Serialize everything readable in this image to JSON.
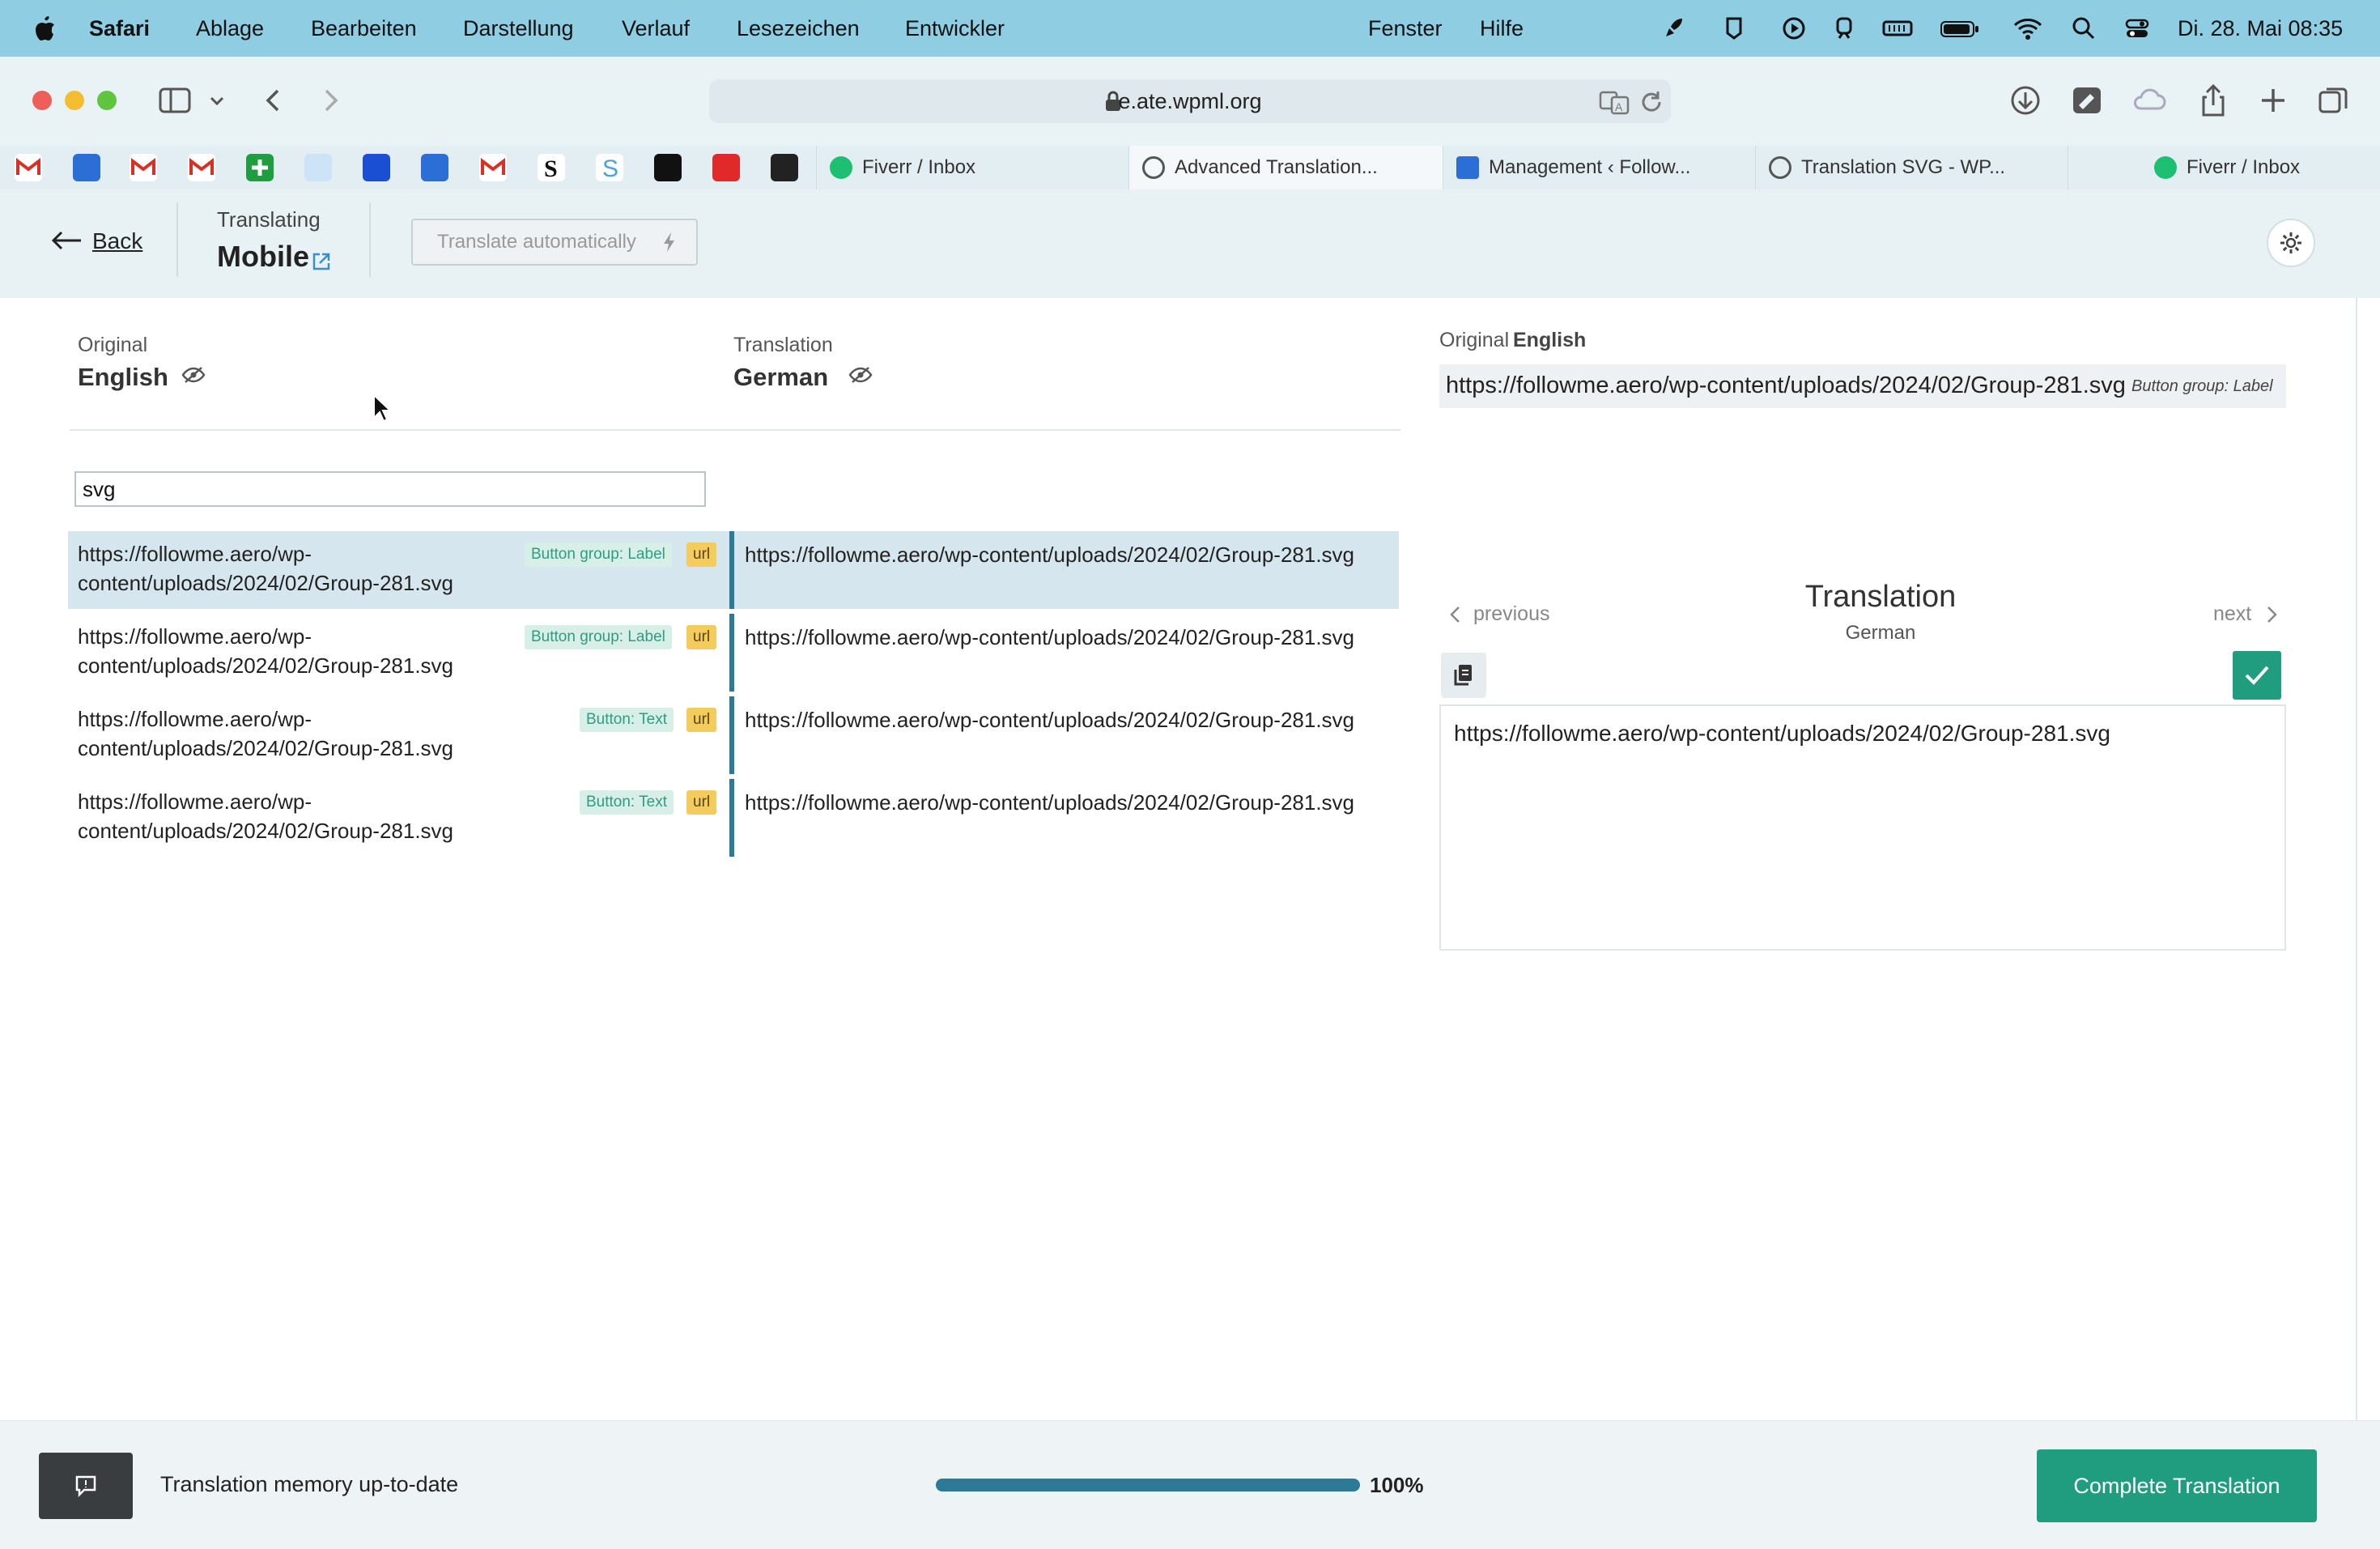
{
  "menubar": {
    "app_name": "Safari",
    "items": [
      "Ablage",
      "Bearbeiten",
      "Darstellung",
      "Verlauf",
      "Lesezeichen",
      "Entwickler",
      "Fenster",
      "Hilfe"
    ],
    "clock": "Di. 28. Mai  08:35"
  },
  "browser": {
    "url": "e.ate.wpml.org",
    "tabs": [
      {
        "label": "Fiverr / Inbox",
        "icon": "fiverr-icon"
      },
      {
        "label": "Advanced Translation...",
        "icon": "wpml-icon",
        "active": true
      },
      {
        "label": "Management ‹ Follow...",
        "icon": "management-icon"
      },
      {
        "label": "Translation SVG - WP...",
        "icon": "wpml-icon"
      },
      {
        "label": "Fiverr / Inbox",
        "icon": "fiverr-icon"
      }
    ]
  },
  "header": {
    "back_label": "Back",
    "translating_label": "Translating",
    "doc_title": "Mobile",
    "auto_translate_label": "Translate automatically"
  },
  "languages": {
    "original_label": "Original",
    "original_name": "English",
    "translation_label": "Translation",
    "translation_name": "German"
  },
  "search": {
    "value": "svg"
  },
  "rows": [
    {
      "source": "https://followme.aero/wp-content/uploads/2024/02/Group-281.svg",
      "source_line1": "https://followme.aero/wp-",
      "source_line2": "content/uploads/2024/02/Group-281.svg",
      "tag": "Button group: Label",
      "type": "url",
      "target": "https://followme.aero/wp-content/uploads/2024/02/Group-281.svg",
      "selected": true
    },
    {
      "source": "https://followme.aero/wp-content/uploads/2024/02/Group-281.svg",
      "source_line1": "https://followme.aero/wp-",
      "source_line2": "content/uploads/2024/02/Group-281.svg",
      "tag": "Button group: Label",
      "type": "url",
      "target": "https://followme.aero/wp-content/uploads/2024/02/Group-281.svg"
    },
    {
      "source": "https://followme.aero/wp-content/uploads/2024/02/Group-281.svg",
      "source_line1": "https://followme.aero/wp-",
      "source_line2": "content/uploads/2024/02/Group-281.svg",
      "tag": "Button: Text",
      "type": "url",
      "target": "https://followme.aero/wp-content/uploads/2024/02/Group-281.svg"
    },
    {
      "source": "https://followme.aero/wp-content/uploads/2024/02/Group-281.svg",
      "source_line1": "https://followme.aero/wp-",
      "source_line2": "content/uploads/2024/02/Group-281.svg",
      "tag": "Button: Text",
      "type": "url",
      "target": "https://followme.aero/wp-content/uploads/2024/02/Group-281.svg"
    }
  ],
  "right_panel": {
    "original_label": "Original",
    "original_lang": "English",
    "original_text": "https://followme.aero/wp-content/uploads/2024/02/Group-281.svg",
    "original_tag": "Button group: Label",
    "previous_label": "previous",
    "next_label": "next",
    "title": "Translation",
    "subtitle": "German",
    "translation_text": "https://followme.aero/wp-content/uploads/2024/02/Group-281.svg"
  },
  "footer": {
    "memory_text": "Translation memory up-to-date",
    "progress": 1.0,
    "progress_label": "100%",
    "complete_label": "Complete Translation"
  },
  "colors": {
    "accent": "#1f9d7e",
    "progress": "#2b7a96",
    "selected_row": "#d6e6ef",
    "menubar": "#8fcde3",
    "url_badge": "#f4cc5e"
  }
}
